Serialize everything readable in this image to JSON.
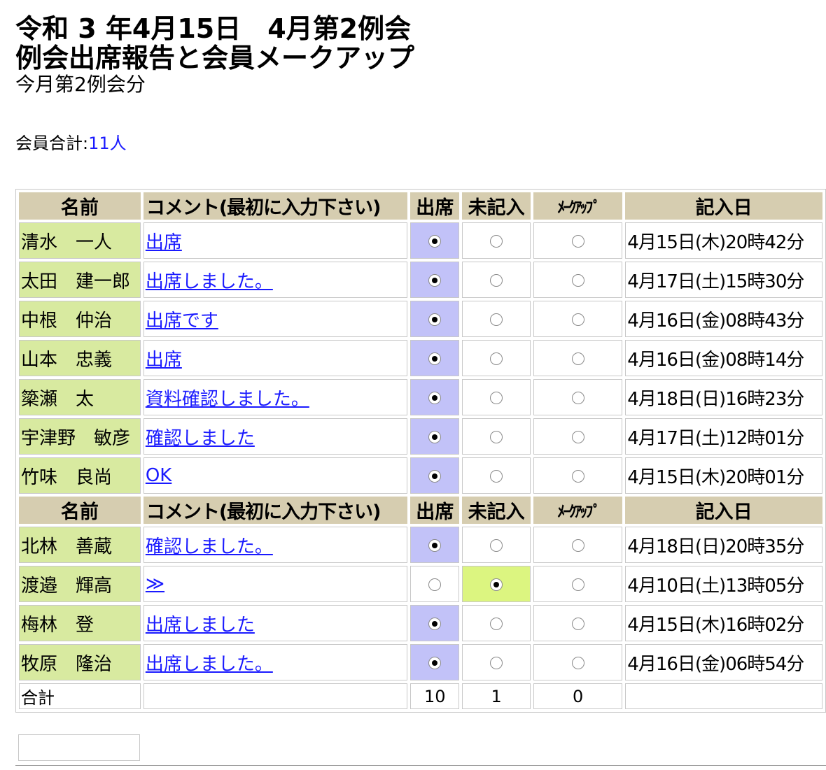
{
  "header": {
    "line1": "令和 3 年4月15日　4月第2例会",
    "line2": "例会出席報告と会員メークアップ",
    "line3": "今月第2例会分"
  },
  "member_total": {
    "label": "会員合計:",
    "count": "11人"
  },
  "table": {
    "headers": {
      "name": "名前",
      "comment": "コメント(最初に入力下さい)",
      "attend": "出席",
      "none": "未記入",
      "makeup": "ﾒｰｸｱｯﾌﾟ",
      "date": "記入日"
    },
    "group1": [
      {
        "name": "清水　一人",
        "comment": "出席",
        "status": "attend",
        "date": "4月15日(木)20時42分"
      },
      {
        "name": "太田　建一郎",
        "comment": "出席しました。",
        "status": "attend",
        "date": "4月17日(土)15時30分"
      },
      {
        "name": "中根　仲治",
        "comment": "出席です",
        "status": "attend",
        "date": "4月16日(金)08時43分"
      },
      {
        "name": "山本　忠義",
        "comment": "出席",
        "status": "attend",
        "date": "4月16日(金)08時14分"
      },
      {
        "name": "簗瀬　太",
        "comment": "資料確認しました。",
        "status": "attend",
        "date": "4月18日(日)16時23分"
      },
      {
        "name": "宇津野　敏彦",
        "comment": "確認しました",
        "status": "attend",
        "date": "4月17日(土)12時01分"
      },
      {
        "name": "竹味　良尚",
        "comment": "OK",
        "status": "attend",
        "date": "4月15日(木)20時01分"
      }
    ],
    "group2": [
      {
        "name": "北林　善蔵",
        "comment": "確認しました。",
        "status": "attend",
        "date": "4月18日(日)20時35分"
      },
      {
        "name": "渡邉　輝高",
        "comment": "≫",
        "status": "none",
        "date": "4月10日(土)13時05分"
      },
      {
        "name": "梅林　登",
        "comment": "出席しました",
        "status": "attend",
        "date": "4月15日(木)16時02分"
      },
      {
        "name": "牧原　隆治",
        "comment": "出席しました。",
        "status": "attend",
        "date": "4月16日(金)06時54分"
      }
    ],
    "totals": {
      "label": "合計",
      "attend": "10",
      "none": "1",
      "makeup": "0"
    }
  }
}
